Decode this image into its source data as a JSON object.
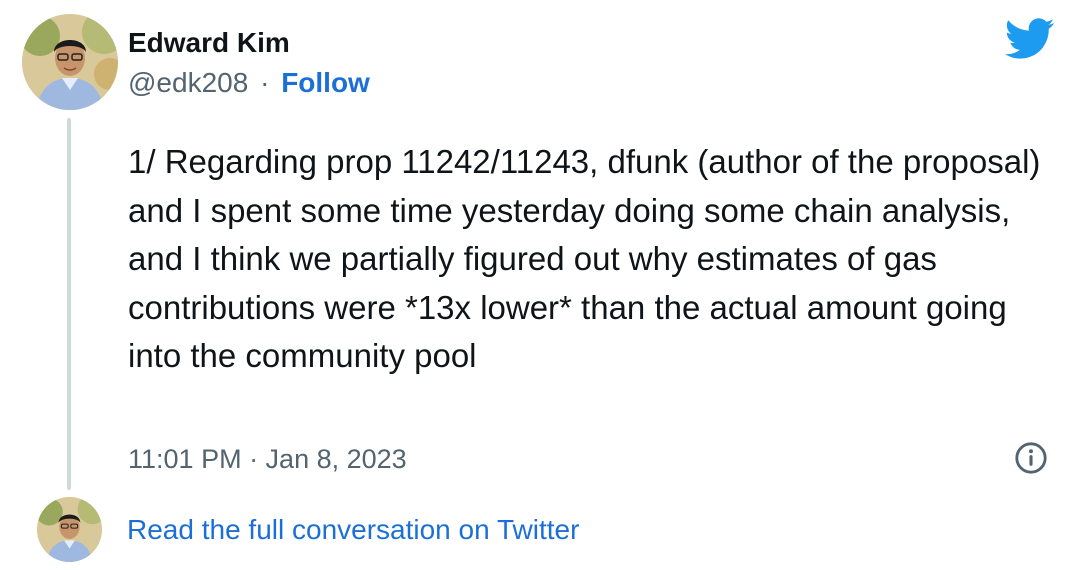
{
  "author": {
    "name": "Edward Kim",
    "handle": "@edk208",
    "separator": "·",
    "follow_label": "Follow"
  },
  "tweet": {
    "text": "1/ Regarding prop 11242/11243, dfunk (author of the proposal) and I spent some time yesterday doing some chain analysis, and I think we partially figured out why estimates of gas contributions were *13x lower* than the actual amount going into the community pool",
    "timestamp": "11:01 PM · Jan 8, 2023"
  },
  "footer": {
    "read_link": "Read the full conversation on Twitter"
  },
  "icons": {
    "brand": "twitter-bird-icon",
    "info": "info-icon"
  },
  "colors": {
    "link": "#1d6fd8",
    "twitter_blue": "#1d9bf0",
    "secondary_text": "#536471",
    "thread_line": "#cfd9de"
  }
}
